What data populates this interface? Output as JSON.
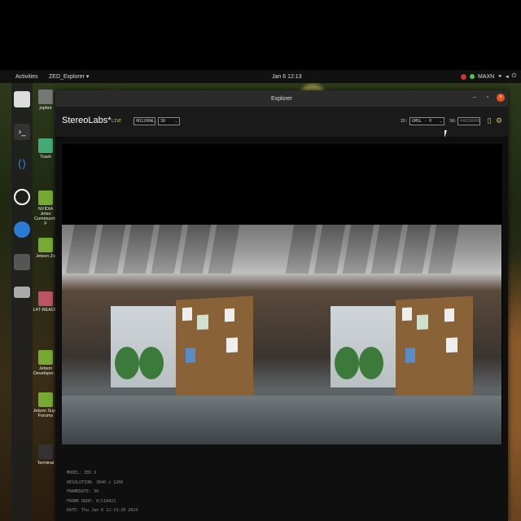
{
  "topbar": {
    "activities": "Activities",
    "app_menu": "ZED_Explorer ▾",
    "clock": "Jan 6  12:13",
    "power_mode": "MAXN"
  },
  "dock": {
    "items": [
      "files-icon",
      "terminal-icon",
      "vscode-icon",
      "obs-icon",
      "chromium-icon",
      "app-icon",
      "drive-icon"
    ]
  },
  "desktop": {
    "icons": [
      {
        "label": "jnpbot",
        "icon": "folder-icon"
      },
      {
        "label": "Trash",
        "icon": "trash-icon"
      },
      {
        "label": "NVIDIA Jetso Community F",
        "icon": "nvidia-icon"
      },
      {
        "label": "Jetson Zo",
        "icon": "nvidia-icon"
      },
      {
        "label": "L4T-READM",
        "icon": "folder-icon"
      },
      {
        "label": "Jetson Developer Z",
        "icon": "nvidia-icon"
      },
      {
        "label": "Jetson Supp Forums",
        "icon": "nvidia-icon"
      },
      {
        "label": "Terminal",
        "icon": "terminal-icon"
      }
    ]
  },
  "window": {
    "title": "Explorer",
    "controls": {
      "minimize": "–",
      "maximize": "▫",
      "close": "×"
    }
  },
  "toolbar": {
    "logo": "StereoLabs*",
    "live": "LIVE",
    "resolution_select": "HD1200W",
    "fps_select": "30",
    "id_label": "ID:",
    "id_select": "GMSL - 0",
    "sn_label": "SN:",
    "sn_value": "44838808"
  },
  "info": {
    "model": "MODEL: ZED X",
    "resolution": "RESOLUTION: 3840 x 1200",
    "framerate": "FRAMERATE: 30",
    "frame_drop": "FRAME DROP: 0/118421",
    "date": "DATE: Thu Jan 6 12:13:20 2024"
  },
  "colors": {
    "accent": "#e0c040",
    "close": "#e95420"
  }
}
